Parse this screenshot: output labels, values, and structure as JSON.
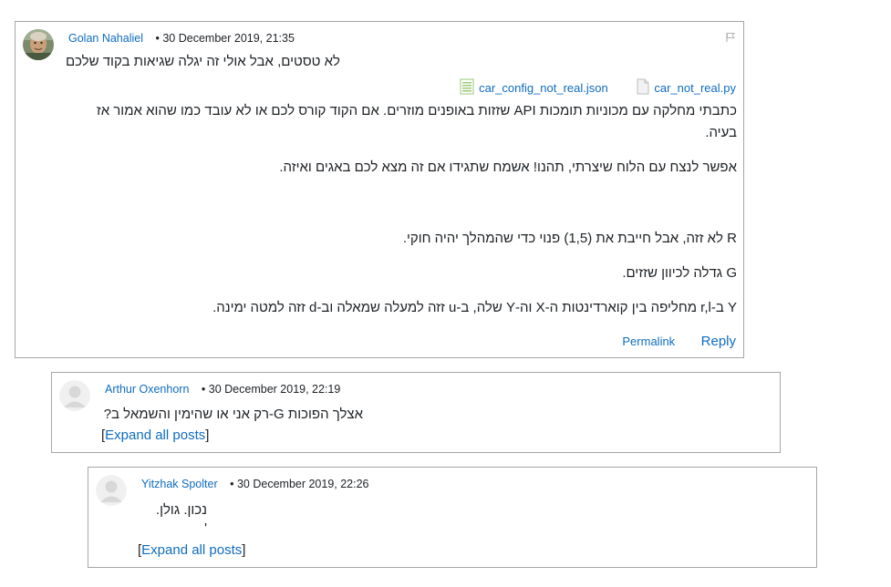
{
  "posts": [
    {
      "author": "Golan Nahaliel",
      "date": "30 December 2019, 21:35",
      "separator": "•",
      "subject": "לא טסטים, אבל אולי זה יגלה שגיאות בקוד שלכם",
      "attachments": [
        {
          "name": "car_not_real.py",
          "icon": "python-file-icon"
        },
        {
          "name": "car_config_not_real.json",
          "icon": "text-file-icon"
        }
      ],
      "paragraphs": [
        "כתבתי מחלקה עם מכוניות תומכות API שזזות באופנים מוזרים. אם הקוד קורס לכם או לא עובד כמו שהוא אמור אז בעיה.",
        "אפשר לנצח עם הלוח שיצרתי, תהנו! אשמח שתגידו אם זה מצא לכם באגים ואיזה.",
        "R לא זזה, אבל חייבת את (1,5) פנוי כדי שהמהלך יהיה חוקי.",
        "G גדלה לכיוון שזזים.",
        "Y ב-r,l מחליפה בין קוארדינטות ה-X וה-Y שלה, ב-u זזה למעלה שמאלה וב-d זזה למטה ימינה."
      ],
      "permalink": "Permalink",
      "reply": "Reply"
    },
    {
      "author": "Arthur Oxenhorn",
      "date": "30 December 2019, 22:19",
      "separator": "•",
      "text": "אצלך הפוכות G-רק אני או שהימין והשמאל ב?",
      "expand_open": "[",
      "expand": "Expand all posts",
      "expand_close": "]"
    },
    {
      "author": "Yitzhak Spolter",
      "date": "30 December 2019, 22:26",
      "separator": "•",
      "text_line1": "נכון. גולן.",
      "text_line2": "'",
      "expand_open": "[",
      "expand": "Expand all posts",
      "expand_close": "]"
    }
  ],
  "colors": {
    "link": "#0f6cbf",
    "border": "#a6a6a6",
    "text": "#1d2125"
  }
}
